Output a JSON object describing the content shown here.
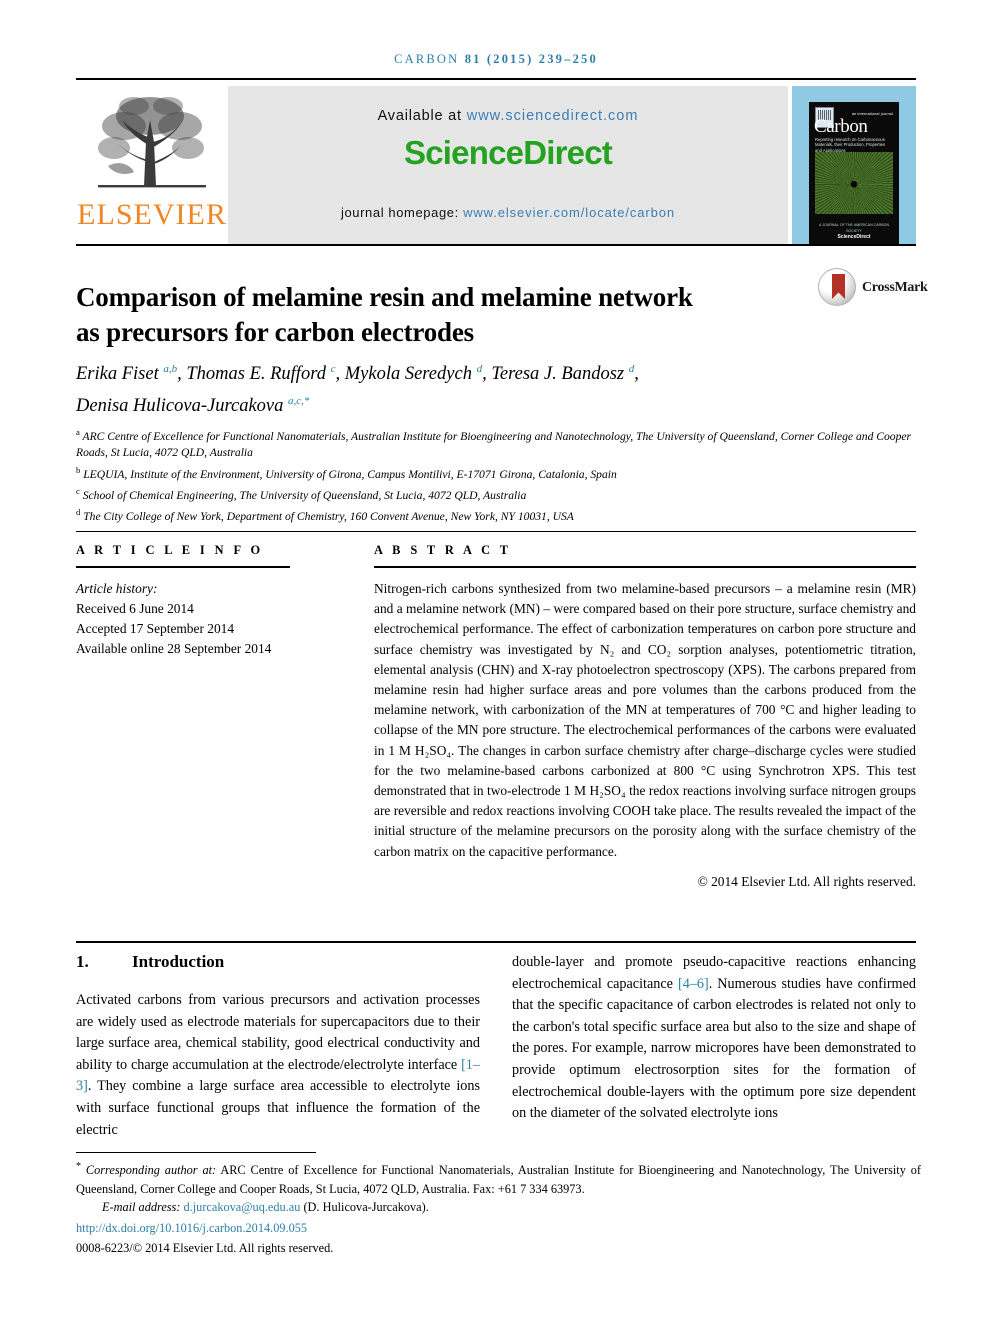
{
  "running_head": {
    "journal": "CARBON",
    "volume_year_pages": "81 (2015) 239–250"
  },
  "masthead": {
    "publisher_name": "ELSEVIER",
    "available_label": "Available at",
    "available_url": "www.sciencedirect.com",
    "sciencedirect_logo": "ScienceDirect",
    "homepage_label": "journal homepage:",
    "homepage_url": "www.elsevier.com/locate/carbon",
    "cover": {
      "kicker": "an international journal",
      "title": "Carbon",
      "subtitle": "Reporting research on Carbonaceous Materials, their Production, Properties and Applications",
      "footer_small": "A JOURNAL OF THE AMERICAN CARBON SOCIETY",
      "footer_brand": "ScienceDirect"
    },
    "colors": {
      "sciencedirect_green": "#25a320",
      "elsevier_orange": "#f08622",
      "link_blue": "#3b7fb5",
      "band_grey": "#e6e6e6",
      "cover_blue": "#8fc9e4"
    }
  },
  "article": {
    "title": "Comparison of melamine resin and melamine network as precursors for carbon electrodes",
    "crossmark_label": "CrossMark",
    "authors_line1": "Erika Fiset",
    "authors": [
      {
        "name": "Erika Fiset",
        "marks": "a,b",
        "sep": ", "
      },
      {
        "name": "Thomas E. Rufford",
        "marks": "c",
        "sep": ", "
      },
      {
        "name": "Mykola Seredych",
        "marks": "d",
        "sep": ", "
      },
      {
        "name": "Teresa J. Bandosz",
        "marks": "d",
        "sep": ","
      },
      {
        "name": "Denisa Hulicova-Jurcakova",
        "marks": "a,c,*",
        "sep": ""
      }
    ],
    "affiliations": [
      {
        "mark": "a",
        "text": "ARC Centre of Excellence for Functional Nanomaterials, Australian Institute for Bioengineering and Nanotechnology, The University of Queensland, Corner College and Cooper Roads, St Lucia, 4072 QLD, Australia"
      },
      {
        "mark": "b",
        "text": "LEQUIA, Institute of the Environment, University of Girona, Campus Montilivi, E-17071 Girona, Catalonia, Spain"
      },
      {
        "mark": "c",
        "text": "School of Chemical Engineering, The University of Queensland, St Lucia, 4072 QLD, Australia"
      },
      {
        "mark": "d",
        "text": "The City College of New York, Department of Chemistry, 160 Convent Avenue, New York, NY 10031, USA"
      }
    ]
  },
  "article_info": {
    "heading": "A R T I C L E   I N F O",
    "history_label": "Article history:",
    "history": [
      "Received 6 June 2014",
      "Accepted 17 September 2014",
      "Available online 28 September 2014"
    ]
  },
  "abstract": {
    "heading": "A B S T R A C T",
    "text": "Nitrogen-rich carbons synthesized from two melamine-based precursors – a melamine resin (MR) and a melamine network (MN) – were compared based on their pore structure, surface chemistry and electrochemical performance. The effect of carbonization temperatures on carbon pore structure and surface chemistry was investigated by N₂ and CO₂ sorption analyses, potentiometric titration, elemental analysis (CHN) and X-ray photoelectron spectroscopy (XPS). The carbons prepared from melamine resin had higher surface areas and pore volumes than the carbons produced from the melamine network, with carbonization of the MN at temperatures of 700 °C and higher leading to collapse of the MN pore structure. The electrochemical performances of the carbons were evaluated in 1 M H₂SO₄. The changes in carbon surface chemistry after charge–discharge cycles were studied for the two melamine-based carbons carbonized at 800 °C using Synchrotron XPS. This test demonstrated that in two-electrode 1 M H₂SO₄ the redox reactions involving surface nitrogen groups are reversible and redox reactions involving COOH take place. The results revealed the impact of the initial structure of the melamine precursors on the porosity along with the surface chemistry of the carbon matrix on the capacitive performance.",
    "copyright": "© 2014 Elsevier Ltd. All rights reserved."
  },
  "introduction": {
    "number": "1.",
    "heading": "Introduction",
    "left_paragraph_part1": "Activated carbons from various precursors and activation processes are widely used as electrode materials for supercapacitors due to their large surface area, chemical stability, good electrical conductivity and ability to charge accumulation at the electrode/electrolyte interface ",
    "left_citation": "[1–3]",
    "left_paragraph_part2": ". They combine a large surface area accessible to electrolyte ions with surface functional groups that influence the formation of the electric",
    "right_paragraph_part1": "double-layer and promote pseudo-capacitive reactions enhancing electrochemical capacitance ",
    "right_citation": "[4–6]",
    "right_paragraph_part2": ". Numerous studies have confirmed that the specific capacitance of carbon electrodes is related not only to the carbon's total specific surface area but also to the size and shape of the pores. For example, narrow micropores have been demonstrated to provide optimum electrosorption sites for the formation of electrochemical double-layers with the optimum pore size dependent on the diameter of the solvated electrolyte ions"
  },
  "footer": {
    "corresponding_prefix": "Corresponding author at:",
    "corresponding_text": " ARC Centre of Excellence for Functional Nanomaterials, Australian Institute for Bioengineering and Nanotechnology, The University of Queensland, Corner College and Cooper Roads, St Lucia, 4072 QLD, Australia. Fax: +61 7 334 63973.",
    "email_label": "E-mail address:",
    "email": "d.jurcakova@uq.edu.au",
    "email_owner": "(D. Hulicova-Jurcakova).",
    "doi": "http://dx.doi.org/10.1016/j.carbon.2014.09.055",
    "issn_line": "0008-6223/© 2014 Elsevier Ltd. All rights reserved."
  }
}
